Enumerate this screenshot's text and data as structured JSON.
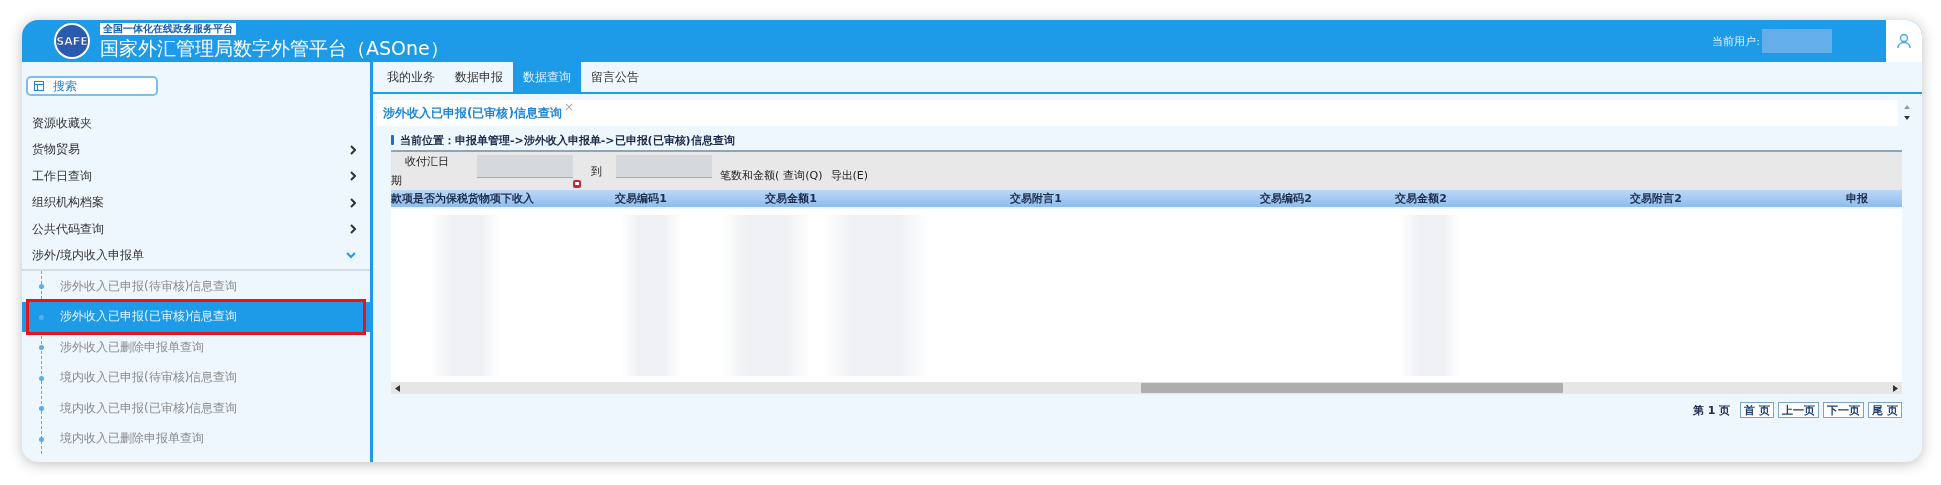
{
  "header": {
    "logo_text": "SAFE",
    "badge": "全国一体化在线政务服务平台",
    "title": "国家外汇管理局数字外管平台（ASOne）",
    "user_label": "当前用户:"
  },
  "sidebar": {
    "search": {
      "label": "搜索"
    },
    "items": [
      {
        "label": "资源收藏夹",
        "kind": "plain"
      },
      {
        "label": "货物贸易",
        "kind": "group",
        "expanded": false
      },
      {
        "label": "工作日查询",
        "kind": "group",
        "expanded": false
      },
      {
        "label": "组织机构档案",
        "kind": "group",
        "expanded": false
      },
      {
        "label": "公共代码查询",
        "kind": "group",
        "expanded": false
      },
      {
        "label": "涉外/境内收入申报单",
        "kind": "group",
        "expanded": true,
        "children": [
          {
            "label": "涉外收入已申报(待审核)信息查询",
            "selected": false,
            "annotated": false
          },
          {
            "label": "涉外收入已申报(已审核)信息查询",
            "selected": true,
            "annotated": true
          },
          {
            "label": "涉外收入已删除申报单查询",
            "selected": false,
            "annotated": false
          },
          {
            "label": "境内收入已申报(待审核)信息查询",
            "selected": false,
            "annotated": false
          },
          {
            "label": "境内收入已申报(已审核)信息查询",
            "selected": false,
            "annotated": false
          },
          {
            "label": "境内收入已删除申报单查询",
            "selected": false,
            "annotated": false
          }
        ]
      }
    ]
  },
  "tabs": [
    {
      "label": "我的业务",
      "selected": false
    },
    {
      "label": "数据申报",
      "selected": false
    },
    {
      "label": "数据查询",
      "selected": true
    },
    {
      "label": "留言公告",
      "selected": false
    }
  ],
  "page_tab": {
    "title": "涉外收入已申报(已审核)信息查询",
    "close": "×"
  },
  "breadcrumb": "当前位置：申报单管理->涉外收入申报单->已申报(已审核)信息查询",
  "filter": {
    "date_label_1": "收付汇日",
    "date_label_2": "期",
    "to_label": "到",
    "count_label": "笔数和金额(",
    "query_button": "查询(Q)",
    "export_button": "导出(E)"
  },
  "table": {
    "columns": [
      "款项是否为保税货物项下收入",
      "交易编码1",
      "交易金额1",
      "交易附言1",
      "交易编码2",
      "交易金额2",
      "交易附言2",
      "申报"
    ]
  },
  "pagination": {
    "page_info": "第 1 页",
    "buttons": [
      "首 页",
      "上一页",
      "下一页",
      "尾 页"
    ]
  }
}
